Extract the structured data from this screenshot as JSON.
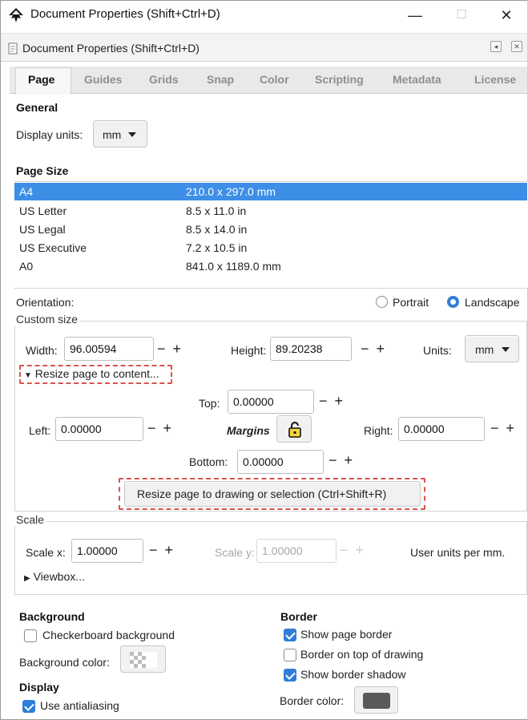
{
  "window": {
    "title": "Document Properties (Shift+Ctrl+D)",
    "minimize_glyph": "—",
    "maximize_glyph": "☐",
    "close_glyph": "✕"
  },
  "dialog": {
    "title": "Document Properties (Shift+Ctrl+D)",
    "dock_glyph": "◂",
    "close_glyph": "✕"
  },
  "tabs": [
    {
      "label": "Page",
      "active": true
    },
    {
      "label": "Guides"
    },
    {
      "label": "Grids"
    },
    {
      "label": "Snap"
    },
    {
      "label": "Color"
    },
    {
      "label": "Scripting"
    },
    {
      "label": "Metadata"
    },
    {
      "label": "License"
    }
  ],
  "general": {
    "heading": "General",
    "display_units_label": "Display units:",
    "display_units_value": "mm"
  },
  "page_size": {
    "heading": "Page Size",
    "rows": [
      {
        "name": "A4",
        "size": "210.0 x 297.0 mm",
        "selected": true
      },
      {
        "name": "US Letter",
        "size": "8.5 x 11.0 in"
      },
      {
        "name": "US Legal",
        "size": "8.5 x 14.0 in"
      },
      {
        "name": "US Executive",
        "size": "7.2 x 10.5 in"
      },
      {
        "name": "A0",
        "size": "841.0 x 1189.0 mm"
      }
    ]
  },
  "orientation": {
    "label": "Orientation:",
    "portrait": "Portrait",
    "landscape": "Landscape",
    "selected": "Landscape"
  },
  "custom_size": {
    "legend": "Custom size",
    "width_label": "Width:",
    "width_value": "96.00594",
    "height_label": "Height:",
    "height_value": "89.20238",
    "units_label": "Units:",
    "units_value": "mm",
    "stepper": "− +",
    "resize_expander": "Resize page to content...",
    "top_label": "Top:",
    "top_value": "0.00000",
    "left_label": "Left:",
    "left_value": "0.00000",
    "margins_label": "Margins",
    "right_label": "Right:",
    "right_value": "0.00000",
    "bottom_label": "Bottom:",
    "bottom_value": "0.00000",
    "resize_button": "Resize page to drawing or selection (Ctrl+Shift+R)"
  },
  "scale": {
    "legend": "Scale",
    "scale_x_label": "Scale x:",
    "scale_x_value": "1.00000",
    "scale_y_label": "Scale y:",
    "scale_y_value": "1.00000",
    "user_units": "User units per mm.",
    "viewbox_label": "Viewbox..."
  },
  "background": {
    "heading": "Background",
    "checkerboard_label": "Checkerboard background",
    "checkerboard_checked": false,
    "color_label": "Background color:"
  },
  "border": {
    "heading": "Border",
    "show_border_label": "Show page border",
    "show_border_checked": true,
    "on_top_label": "Border on top of drawing",
    "on_top_checked": false,
    "shadow_label": "Show border shadow",
    "shadow_checked": true,
    "color_label": "Border color:",
    "color": "#5a5a5a"
  },
  "display": {
    "heading": "Display",
    "antialias_label": "Use antialiasing",
    "antialias_checked": true
  },
  "colors": {
    "selection": "#3d8ee6",
    "accent": "#2f7ed8",
    "highlight_dash": "#d9534f"
  }
}
